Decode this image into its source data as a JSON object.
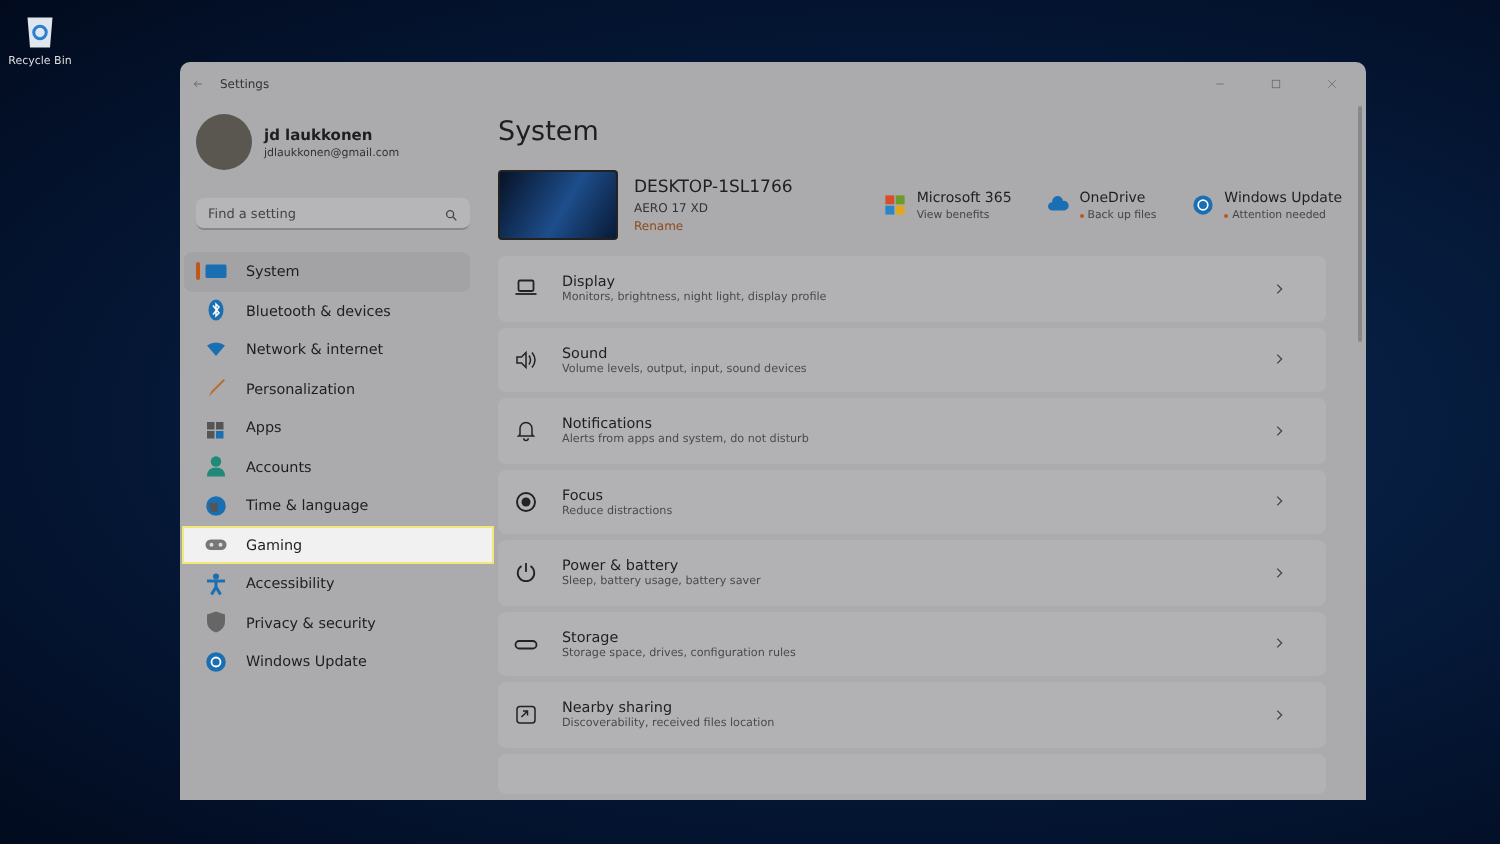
{
  "desktop": {
    "icons": [
      {
        "label": "Recycle Bin"
      }
    ]
  },
  "window": {
    "title": "Settings"
  },
  "account": {
    "name": "jd laukkonen",
    "email": "jdlaukkonen@gmail.com"
  },
  "search": {
    "placeholder": "Find a setting"
  },
  "sidebar": {
    "items": [
      {
        "label": "System",
        "selected": true,
        "highlighted": false
      },
      {
        "label": "Bluetooth & devices",
        "selected": false,
        "highlighted": false
      },
      {
        "label": "Network & internet",
        "selected": false,
        "highlighted": false
      },
      {
        "label": "Personalization",
        "selected": false,
        "highlighted": false
      },
      {
        "label": "Apps",
        "selected": false,
        "highlighted": false
      },
      {
        "label": "Accounts",
        "selected": false,
        "highlighted": false
      },
      {
        "label": "Time & language",
        "selected": false,
        "highlighted": false
      },
      {
        "label": "Gaming",
        "selected": false,
        "highlighted": true
      },
      {
        "label": "Accessibility",
        "selected": false,
        "highlighted": false
      },
      {
        "label": "Privacy & security",
        "selected": false,
        "highlighted": false
      },
      {
        "label": "Windows Update",
        "selected": false,
        "highlighted": false
      }
    ]
  },
  "page": {
    "title": "System"
  },
  "device": {
    "name": "DESKTOP-1SL1766",
    "model": "AERO 17 XD",
    "rename": "Rename"
  },
  "quick_links": [
    {
      "title": "Microsoft 365",
      "subtitle": "View benefits",
      "alert": false
    },
    {
      "title": "OneDrive",
      "subtitle": "Back up files",
      "alert": true
    },
    {
      "title": "Windows Update",
      "subtitle": "Attention needed",
      "alert": true
    }
  ],
  "settings": [
    {
      "title": "Display",
      "subtitle": "Monitors, brightness, night light, display profile"
    },
    {
      "title": "Sound",
      "subtitle": "Volume levels, output, input, sound devices"
    },
    {
      "title": "Notifications",
      "subtitle": "Alerts from apps and system, do not disturb"
    },
    {
      "title": "Focus",
      "subtitle": "Reduce distractions"
    },
    {
      "title": "Power & battery",
      "subtitle": "Sleep, battery usage, battery saver"
    },
    {
      "title": "Storage",
      "subtitle": "Storage space, drives, configuration rules"
    },
    {
      "title": "Nearby sharing",
      "subtitle": "Discoverability, received files location"
    }
  ]
}
